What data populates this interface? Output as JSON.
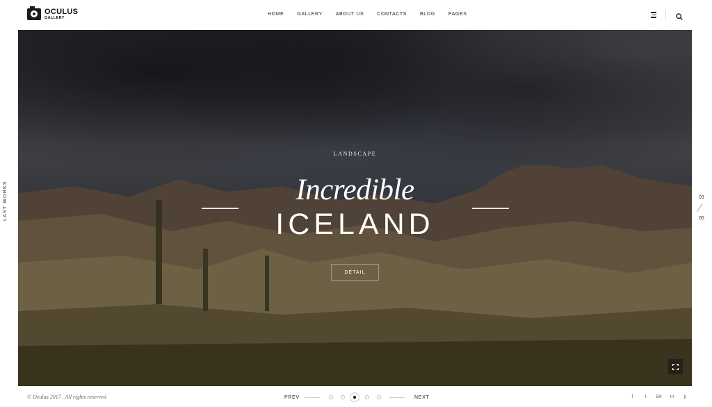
{
  "brand": {
    "name": "OCULUS",
    "sub": "GALLERY"
  },
  "nav": {
    "items": [
      "HOME",
      "GALLERY",
      "ABOUT US",
      "CONTACTS",
      "BLOG",
      "PAGES"
    ]
  },
  "header": {
    "menu_icon": "hamburger-menu-icon",
    "search_icon": "search-icon"
  },
  "side": {
    "label": "LAST WORKS"
  },
  "hero": {
    "category": "LANDSCAPE",
    "title_italic": "Incredible",
    "title_main": "ICELAND",
    "detail_label": "DETAIL",
    "fullscreen_icon": "fullscreen-icon"
  },
  "counter": {
    "current": "03",
    "total": "05"
  },
  "footer": {
    "copyright": "© Oculus 2017 . All rights reserved",
    "prev_label": "PREV",
    "next_label": "NEXT",
    "active_dot": 3,
    "dot_count": 5
  },
  "social": {
    "icons": [
      "facebook-icon",
      "twitter-icon",
      "behance-icon",
      "linkedin-icon",
      "pinterest-icon"
    ],
    "glyphs": [
      "f",
      "t",
      "Bē",
      "in",
      "p"
    ]
  }
}
